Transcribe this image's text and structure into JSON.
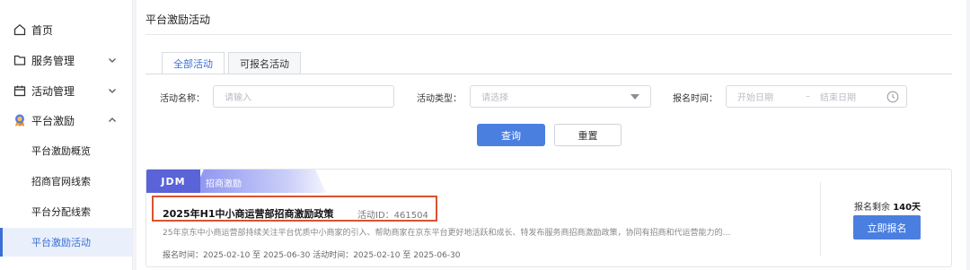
{
  "sidebar": {
    "items": [
      {
        "label": "首页",
        "icon": "home-icon"
      },
      {
        "label": "服务管理",
        "icon": "folder-icon"
      },
      {
        "label": "活动管理",
        "icon": "calendar-icon"
      },
      {
        "label": "平台激励",
        "icon": "medal-icon"
      }
    ],
    "sub_items": [
      "平台激励概览",
      "招商官网线索",
      "平台分配线索",
      "平台激励活动"
    ],
    "active_sub": "平台激励活动"
  },
  "page": {
    "title": "平台激励活动"
  },
  "tabs": [
    {
      "label": "全部活动",
      "active": true
    },
    {
      "label": "可报名活动",
      "active": false
    }
  ],
  "filters": {
    "name_label": "活动名称：",
    "name_placeholder": "请输入",
    "type_label": "活动类型：",
    "type_placeholder": "请选择",
    "time_label": "报名时间：",
    "start_placeholder": "开始日期",
    "range_sep": "–",
    "end_placeholder": "结束日期",
    "query_label": "查询",
    "reset_label": "重置"
  },
  "card": {
    "brand_logo": "JDM",
    "brand_text": "招商激励",
    "title": "2025年H1中小商运营部招商激励政策",
    "activity_id": "活动ID：461504",
    "description": "25年京东中小商运营部持续关注平台优质中小商家的引入、帮助商家在京东平台更好地活跃和成长、特发布服务商招商激励政策，协同有招商和代运营能力的…",
    "dates": "报名时间：2025-02-10 至 2025-06-30 活动时间：2025-02-10 至 2025-06-30",
    "remain_prefix": "报名剩余",
    "remain_days": "140天",
    "signup_label": "立即报名"
  },
  "colors": {
    "accent": "#4a7fe0",
    "highlight": "#d9532f",
    "brand": "#5a63d8"
  }
}
